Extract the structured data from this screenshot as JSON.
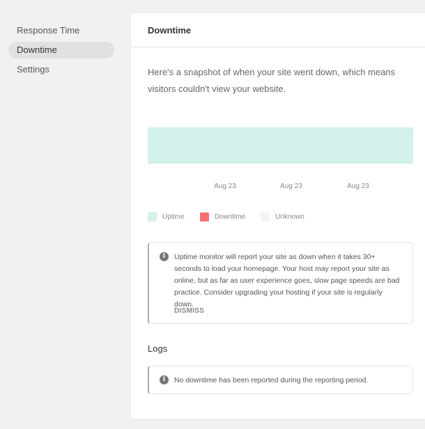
{
  "sidebar": {
    "items": [
      {
        "label": "Response Time",
        "active": false
      },
      {
        "label": "Downtime",
        "active": true
      },
      {
        "label": "Settings",
        "active": false
      }
    ]
  },
  "card": {
    "title": "Downtime",
    "intro": "Here's a snapshot of when your site went down, which means visitors couldn't view your website.",
    "dates": [
      "Aug 23",
      "Aug 23",
      "Aug 23"
    ],
    "legend": [
      {
        "label": "Uptime",
        "color": "#d1f1ea"
      },
      {
        "label": "Downtime",
        "color": "#f57070"
      },
      {
        "label": "Unknown",
        "color": "#f3f3f7"
      }
    ],
    "notice": {
      "icon": "info-icon",
      "text": "Uptime monitor will report your site as down when it takes 30+ seconds to load your homepage. Your host may report your site as online, but as far as user experience goes, slow page speeds are bad practice. Consider upgrading your hosting if your site is regularly down.",
      "dismiss_label": "DISMISS"
    },
    "logs": {
      "title": "Logs",
      "icon": "info-icon",
      "empty_text": "No downtime has been reported during the reporting period."
    }
  }
}
